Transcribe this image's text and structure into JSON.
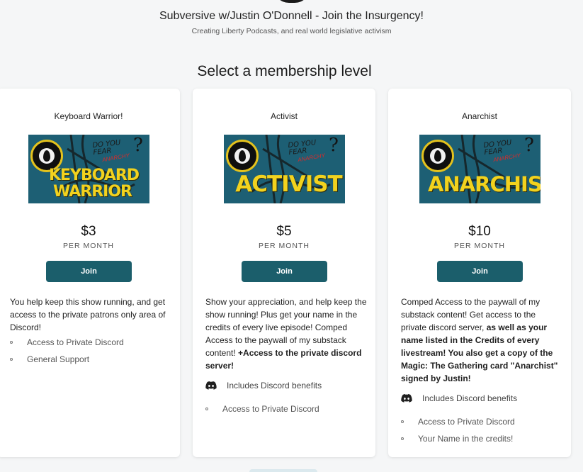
{
  "creator": {
    "name": "Subversive w/Justin O'Donnell - Join the Insurgency!",
    "tagline": "Creating Liberty Podcasts, and real world legislative activism"
  },
  "section_title": "Select a membership level",
  "colors": {
    "join_button": "#1b5e6b",
    "card_bg": "#ffffff",
    "page_bg": "#f5f6f7"
  },
  "tiers": [
    {
      "name": "Keyboard Warrior!",
      "image": {
        "top_text": "DO YOU FEAR",
        "overlay": "ANARCHY",
        "word1": "KEYBOARD",
        "word2": "WARRIOR",
        "qmark": "?"
      },
      "price": "$3",
      "period": "PER MONTH",
      "join_label": "Join",
      "description": "You help keep this show running, and get access to the private patrons only area of Discord!",
      "benefits": [
        "Access to Private Discord",
        "General Support"
      ]
    },
    {
      "name": "Activist",
      "image": {
        "top_text": "DO YOU FEAR",
        "overlay": "ANARCHY",
        "word": "ACTIVIST",
        "qmark": "?"
      },
      "price": "$5",
      "period": "PER MONTH",
      "join_label": "Join",
      "description_plain": "Show your appreciation, and help keep the show running!  Plus get your name in the credits of every live episode! Comped Access to the paywall of my substack content!  ",
      "description_bold": "+Access to the private discord server!",
      "discord_label": "Includes Discord benefits",
      "benefits": [
        "Access to Private Discord"
      ]
    },
    {
      "name": "Anarchist",
      "image": {
        "top_text": "DO YOU FEAR",
        "overlay": "ANARCHY",
        "word": "ANARCHIST",
        "qmark": "?"
      },
      "price": "$10",
      "period": "PER MONTH",
      "join_label": "Join",
      "description_plain": "Comped Access to the paywall of my substack content! Get access to the private discord server, ",
      "description_bold": "as well as your name listed in the Credits of every livestream! You also get a copy of the Magic: The Gathering card \"Anarchist\" signed by Justin!",
      "discord_label": "Includes Discord benefits",
      "benefits": [
        "Access to Private Discord",
        "Your Name in the credits!"
      ]
    }
  ]
}
